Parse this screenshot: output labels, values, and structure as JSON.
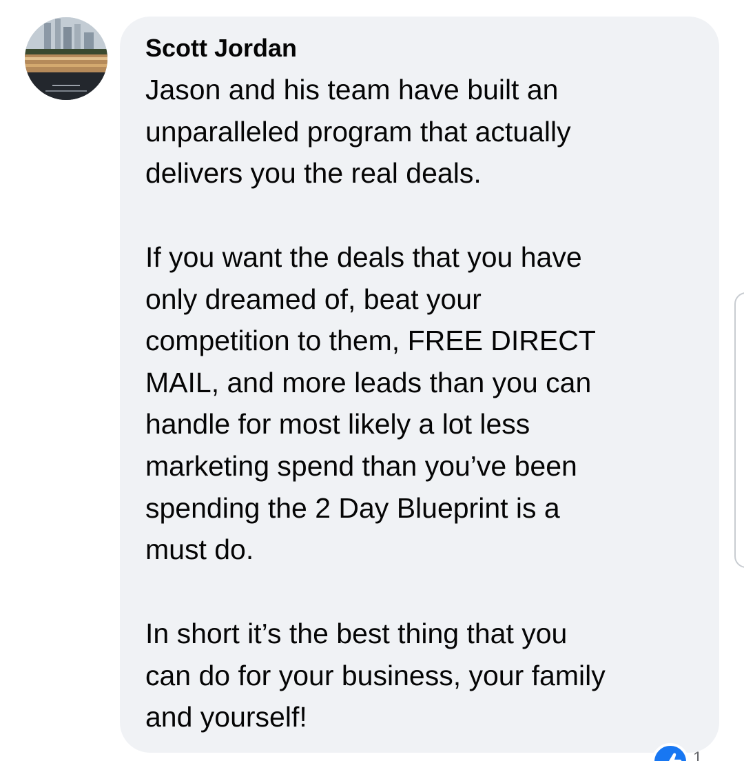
{
  "comment": {
    "author": "Scott Jordan",
    "paragraphs": [
      [
        "Jason and his team have built an",
        "unparalleled program that actually",
        "delivers you the real deals."
      ],
      [
        "If you want the deals that you have",
        "only dreamed of, beat your",
        "competition to them, FREE DIRECT",
        "MAIL, and more leads than you can",
        "handle for most likely a lot less",
        "marketing spend than you’ve been",
        "spending the 2 Day Blueprint is a",
        "must do."
      ],
      [
        "In short it’s the best thing that you",
        "can do for your business, your family",
        "and yourself!"
      ]
    ],
    "reaction": {
      "icon": "like-icon",
      "count": "1",
      "color": "#1877f2"
    }
  },
  "colors": {
    "bubble": "#f0f2f5",
    "text": "#050505"
  }
}
